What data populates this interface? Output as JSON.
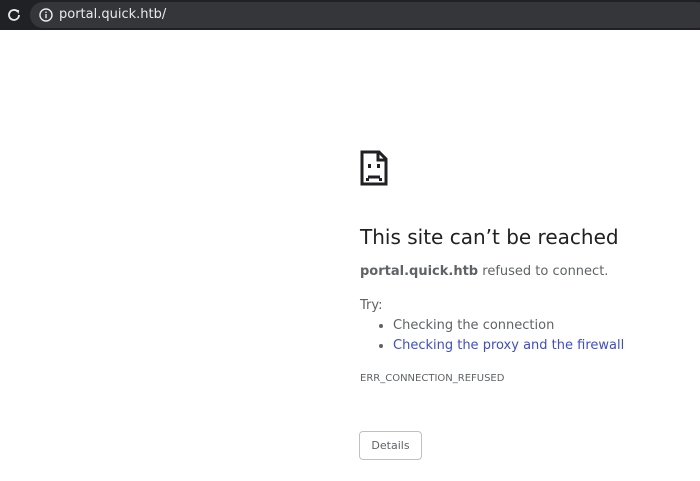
{
  "browser": {
    "url": "portal.quick.htb/",
    "reload_icon": "reload-icon",
    "info_icon": "info-icon",
    "toolbar_color": "#202124",
    "omnibox_color": "#35363a"
  },
  "error_page": {
    "icon": "sad-page-icon",
    "title": "This site can’t be reached",
    "host": "portal.quick.htb",
    "message": " refused to connect.",
    "try_label": "Try:",
    "suggestions": [
      {
        "text": "Checking the connection",
        "is_link": false
      },
      {
        "text": "Checking the proxy and the firewall",
        "is_link": true
      }
    ],
    "error_code": "ERR_CONNECTION_REFUSED",
    "details_label": "Details",
    "link_color": "#3c4cd8"
  }
}
